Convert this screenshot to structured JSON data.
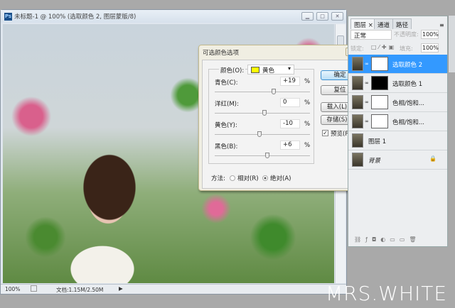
{
  "document": {
    "title": "未标题-1 @ 100% (选取颜色 2, 图层蒙版/8)",
    "zoom": "100%",
    "doc_size": "文档:1.15M/2.50M"
  },
  "dialog": {
    "title": "可选颜色选项",
    "color_label": "颜色(O):",
    "color_value": "黄色",
    "swatch": "#ffff00",
    "sliders": [
      {
        "label": "青色(C):",
        "value": "+19",
        "pct": 19
      },
      {
        "label": "洋红(M):",
        "value": "0",
        "pct": 0
      },
      {
        "label": "黄色(Y):",
        "value": "-10",
        "pct": -10
      },
      {
        "label": "黑色(B):",
        "value": "+6",
        "pct": 6
      }
    ],
    "unit": "%",
    "ok": "确定",
    "reset": "复位",
    "load": "载入(L)...",
    "save": "存储(S)...",
    "preview": "预览(P)",
    "preview_checked": true,
    "method_label": "方法:",
    "relative": "相对(R)",
    "absolute": "绝对(A)",
    "method_selected": "absolute"
  },
  "layers_panel": {
    "tabs": [
      "图层",
      "通道",
      "路径"
    ],
    "blend_mode": "正常",
    "opacity_label": "不透明度:",
    "opacity": "100%",
    "lock_label": "锁定:",
    "fill_label": "填充:",
    "fill": "100%",
    "layers": [
      {
        "name": "选取颜色 2",
        "selected": true,
        "mask": "white"
      },
      {
        "name": "选取颜色 1",
        "selected": false,
        "mask": "black"
      },
      {
        "name": "色相/饱和...",
        "selected": false,
        "mask": "white"
      },
      {
        "name": "色相/饱和...",
        "selected": false,
        "mask": "white"
      },
      {
        "name": "图层 1",
        "selected": false
      },
      {
        "name": "背景",
        "selected": false,
        "locked": true
      }
    ]
  },
  "watermark": "MRS.WHITE"
}
